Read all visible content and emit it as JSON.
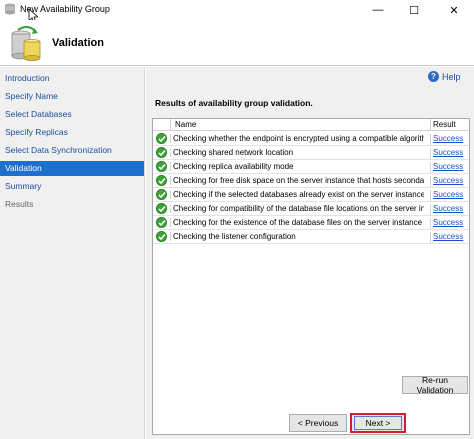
{
  "window": {
    "title": "New Availability Group",
    "minimize_glyph": "—",
    "maximize_glyph": "☐",
    "close_glyph": "✕"
  },
  "header": {
    "title": "Validation",
    "icon": "database-cylinders-icon"
  },
  "nav": {
    "items": [
      {
        "label": "Introduction",
        "state": "link"
      },
      {
        "label": "Specify Name",
        "state": "link"
      },
      {
        "label": "Select Databases",
        "state": "link"
      },
      {
        "label": "Specify Replicas",
        "state": "link"
      },
      {
        "label": "Select Data Synchronization",
        "state": "link"
      },
      {
        "label": "Validation",
        "state": "active"
      },
      {
        "label": "Summary",
        "state": "link"
      },
      {
        "label": "Results",
        "state": "disabled"
      }
    ]
  },
  "content": {
    "help_label": "Help",
    "help_glyph": "?",
    "results_heading": "Results of availability group validation.",
    "grid": {
      "columns": {
        "name": "Name",
        "result": "Result"
      },
      "rows": [
        {
          "name": "Checking whether the endpoint is encrypted using a compatible algorithm",
          "result": "Success"
        },
        {
          "name": "Checking shared network location",
          "result": "Success"
        },
        {
          "name": "Checking replica availability mode",
          "result": "Success"
        },
        {
          "name": "Checking for free disk space on the server instance that hosts secondary r...",
          "result": "Success"
        },
        {
          "name": "Checking if the selected databases already exist on the server instance tha...",
          "result": "Success"
        },
        {
          "name": "Checking for compatibility of the database file locations on the server inst...",
          "result": "Success"
        },
        {
          "name": "Checking for the existence of the database files on the server instance tha...",
          "result": "Success"
        },
        {
          "name": "Checking the listener configuration",
          "result": "Success"
        }
      ]
    },
    "rerun_label": "Re-run Validation"
  },
  "footer": {
    "previous_label": "< Previous",
    "next_label": "Next >"
  },
  "colors": {
    "accent": "#1f6fcf",
    "link": "#1a4f9c",
    "success_icon": "#3fa43a",
    "highlight_border": "#d1202a"
  }
}
